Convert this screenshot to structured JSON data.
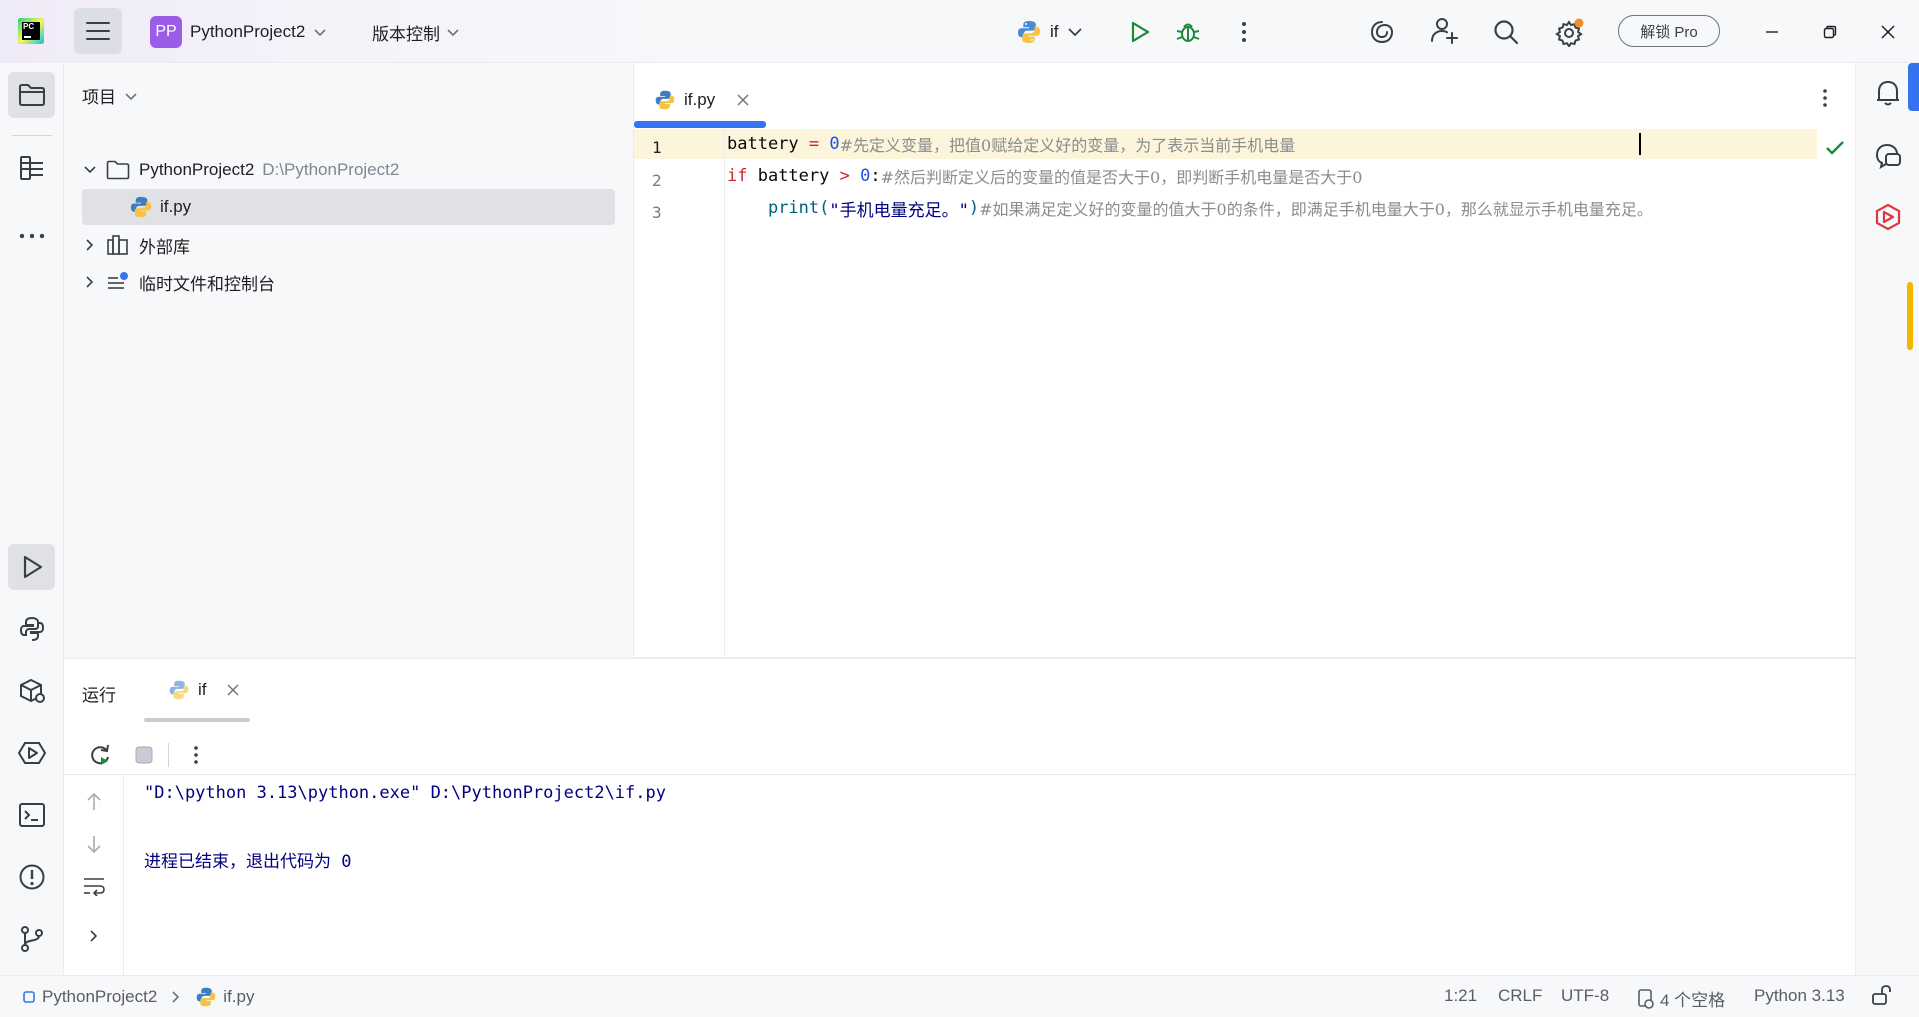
{
  "titlebar": {
    "project_badge": "PP",
    "project_name": "PythonProject2",
    "vcs_label": "版本控制",
    "run_config": "if",
    "unlock_pro": "解锁 Pro",
    "logo_text": "PC"
  },
  "project_panel": {
    "header": "项目",
    "root_name": "PythonProject2",
    "root_path": "D:\\PythonProject2",
    "file_name": "if.py",
    "external_libs": "外部库",
    "scratches": "临时文件和控制台"
  },
  "editor": {
    "tab_label": "if.py",
    "line_numbers": [
      "1",
      "2",
      "3"
    ],
    "lines": {
      "l1": {
        "t1": "battery",
        "t2": " = ",
        "t3": "0",
        "t4": "#先定义变量，把值0赋给定义好的变量，为了表示当前手机电量"
      },
      "l2": {
        "t1": "if",
        "t2": " battery ",
        "t3": ">",
        "t4": " ",
        "t5": "0",
        "t6": ":",
        "t7": "#然后判断定义后的变量的值是否大于0，即判断手机电量是否大于0"
      },
      "l3": {
        "t0": "    ",
        "t1": "print",
        "t2": "(",
        "t3": "\"手机电量充足。\"",
        "t4": ")",
        "t5": "#如果满足定义好的变量的值大于0的条件，即满足手机电量大于0，那么就显示手机电量充足。"
      }
    }
  },
  "run_panel": {
    "title": "运行",
    "tab_label": "if",
    "console": [
      "\"D:\\python 3.13\\python.exe\" D:\\PythonProject2\\if.py",
      "进程已结束，退出代码为 0"
    ]
  },
  "status_bar": {
    "crumb_project": "PythonProject2",
    "crumb_file": "if.py",
    "position": "1:21",
    "line_sep": "CRLF",
    "encoding": "UTF-8",
    "indent": "4 个空格",
    "interpreter": "Python 3.13"
  },
  "colors": {
    "accent": "#3574f0",
    "project_badge": "#9c5de6",
    "run_green": "#208a3c",
    "notification_orange": "#f7b500"
  },
  "icons": {
    "left_strip": [
      "folder-icon",
      "structure-icon",
      "more-icon",
      "run-icon",
      "python-console-icon",
      "python-packages-icon",
      "services-icon",
      "terminal-icon",
      "problems-icon",
      "git-icon"
    ],
    "right_strip": [
      "notifications-icon",
      "ai-chat-icon",
      "jetbrains-ai-icon"
    ]
  }
}
